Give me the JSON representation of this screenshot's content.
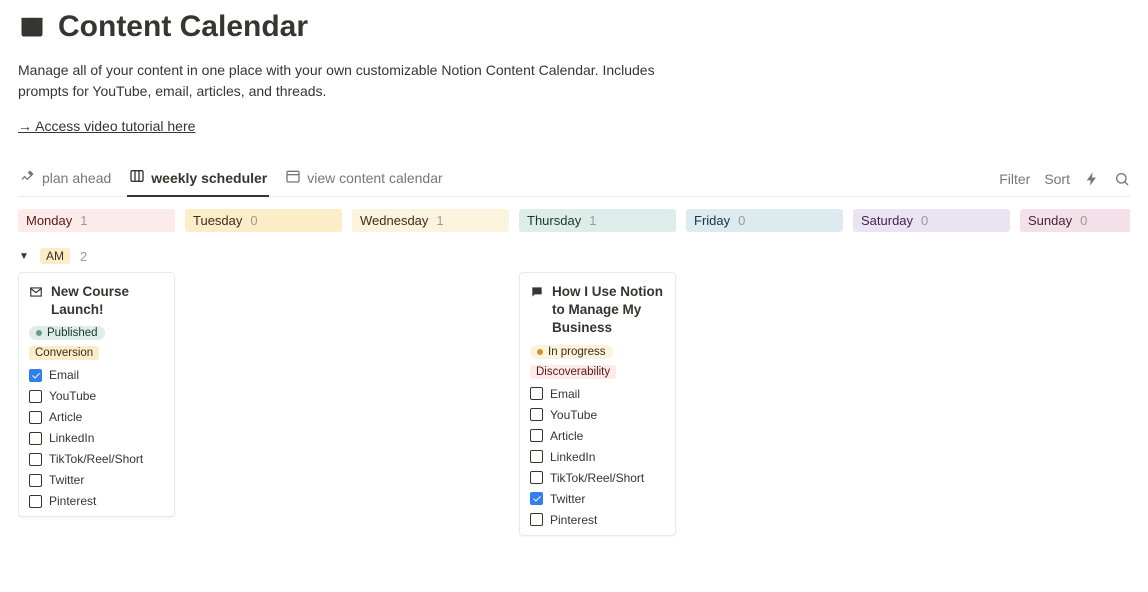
{
  "page": {
    "title": "Content Calendar",
    "description": "Manage all of your content in one place with your own customizable Notion Content Calendar. Includes prompts for YouTube, email, articles, and threads.",
    "tutorial_link": "→ Access video tutorial here"
  },
  "tabs": {
    "plan_ahead": "plan ahead",
    "weekly_scheduler": "weekly scheduler",
    "view_calendar": "view content calendar"
  },
  "toolbar": {
    "filter": "Filter",
    "sort": "Sort"
  },
  "days": {
    "monday": {
      "label": "Monday",
      "count": 1
    },
    "tuesday": {
      "label": "Tuesday",
      "count": 0
    },
    "wednesday": {
      "label": "Wednesday",
      "count": 1
    },
    "thursday": {
      "label": "Thursday",
      "count": 1
    },
    "friday": {
      "label": "Friday",
      "count": 0
    },
    "saturday": {
      "label": "Saturday",
      "count": 0
    },
    "sunday": {
      "label": "Sunday",
      "count": 0
    }
  },
  "group": {
    "label": "AM",
    "count": 2
  },
  "cards": {
    "monday": {
      "title": "New Course Launch!",
      "status": {
        "label": "Published",
        "bg": "#ddedea",
        "fg": "#1c3829",
        "dot": "#6c9b7d"
      },
      "tag": {
        "label": "Conversion",
        "bg": "#fdecc8",
        "fg": "#402c1b"
      },
      "checklist": [
        {
          "label": "Email",
          "checked": true
        },
        {
          "label": "YouTube",
          "checked": false
        },
        {
          "label": "Article",
          "checked": false
        },
        {
          "label": "LinkedIn",
          "checked": false
        },
        {
          "label": "TikTok/Reel/Short",
          "checked": false
        },
        {
          "label": "Twitter",
          "checked": false
        },
        {
          "label": "Pinterest",
          "checked": false
        }
      ]
    },
    "thursday": {
      "title": "How I Use Notion to Manage My Business",
      "status": {
        "label": "In progress",
        "bg": "#fbf3db",
        "fg": "#402c1b",
        "dot": "#cb912f"
      },
      "tag": {
        "label": "Discoverability",
        "bg": "#fdebec",
        "fg": "#5d1715"
      },
      "checklist": [
        {
          "label": "Email",
          "checked": false
        },
        {
          "label": "YouTube",
          "checked": false
        },
        {
          "label": "Article",
          "checked": false
        },
        {
          "label": "LinkedIn",
          "checked": false
        },
        {
          "label": "TikTok/Reel/Short",
          "checked": false
        },
        {
          "label": "Twitter",
          "checked": true
        },
        {
          "label": "Pinterest",
          "checked": false
        }
      ]
    }
  }
}
